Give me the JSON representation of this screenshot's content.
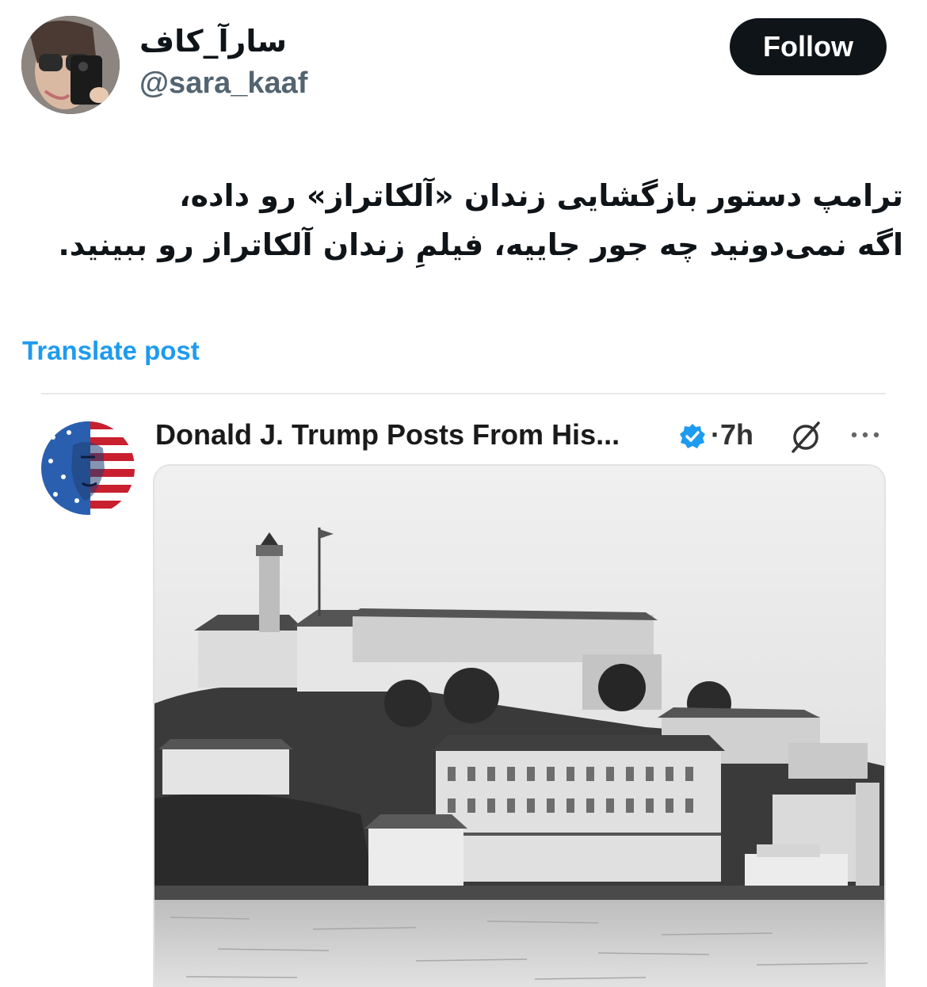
{
  "author": {
    "display_name": "سارآ_کاف",
    "handle": "@sara_kaaf",
    "avatar_icon": "profile-photo"
  },
  "follow_button": {
    "label": "Follow"
  },
  "post": {
    "lines": [
      "ترامپ دستور بازگشایی زندان «آلکاتراز» رو داده،",
      "اگه نمی‌دونید چه جور جاییه، فیلمِ زندان آلکاتراز رو ببینید."
    ],
    "translate_label": "Translate post"
  },
  "embedded": {
    "display_name": "Donald J. Trump Posts From His...",
    "verified_icon": "verified-badge-icon",
    "separator": "·",
    "time": "7h",
    "grok_icon": "grok-icon",
    "more_icon": "more-dots-icon",
    "image_description_icon": "alcatraz-photo"
  },
  "colors": {
    "primary_text": "#0f1419",
    "secondary_text": "#536471",
    "link": "#1d9bf0",
    "follow_bg": "#0f1419",
    "verified": "#1d9bf0"
  }
}
